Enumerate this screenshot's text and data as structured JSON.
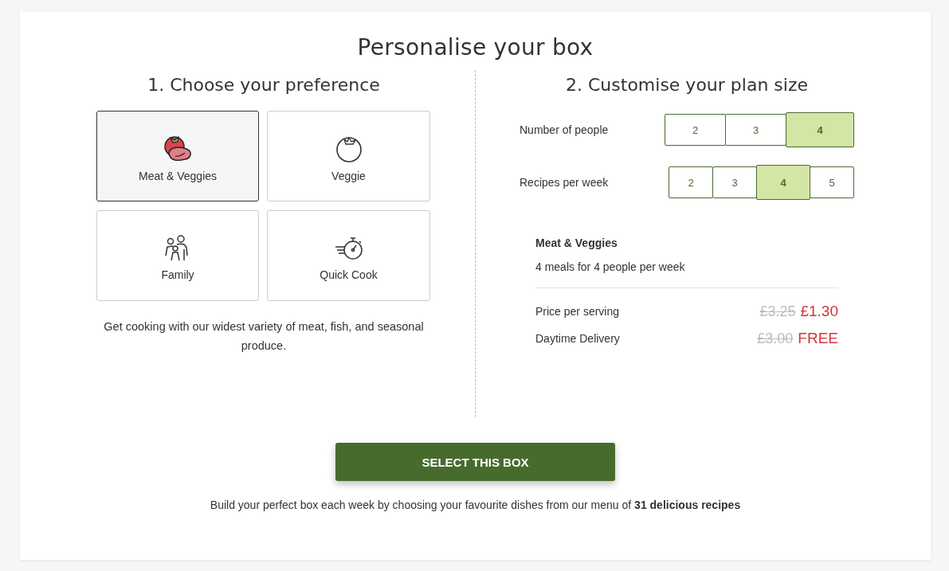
{
  "title": "Personalise your box",
  "preference": {
    "heading": "1. Choose your preference",
    "options": [
      {
        "label": "Meat & Veggies",
        "kind": "meat",
        "selected": true
      },
      {
        "label": "Veggie",
        "kind": "veggie",
        "selected": false
      },
      {
        "label": "Family",
        "kind": "family",
        "selected": false
      },
      {
        "label": "Quick Cook",
        "kind": "quick",
        "selected": false
      }
    ],
    "description": "Get cooking with our widest variety of meat, fish, and seasonal produce."
  },
  "plan": {
    "heading": "2. Customise your plan size",
    "groups": [
      {
        "label": "Number of people",
        "options": [
          {
            "label": "2",
            "selected": false
          },
          {
            "label": "3",
            "selected": false
          },
          {
            "label": "4",
            "selected": true
          }
        ]
      },
      {
        "label": "Recipes per week",
        "options": [
          {
            "label": "2",
            "selected": false
          },
          {
            "label": "3",
            "selected": false
          },
          {
            "label": "4",
            "selected": true
          },
          {
            "label": "5",
            "selected": false
          }
        ]
      }
    ],
    "summary": {
      "name": "Meat & Veggies",
      "meals": "4 meals for 4 people per week",
      "prices": [
        {
          "label": "Price per serving",
          "old_price": "£3.25",
          "price": "£1.30"
        },
        {
          "label": "Daytime Delivery",
          "old_price": "£3.00",
          "price": "FREE"
        }
      ]
    }
  },
  "button": "SELECT THIS BOX",
  "footer": "Build your perfect box each week by choosing your favourite dishes from our menu of **31 delicious recipes**"
}
